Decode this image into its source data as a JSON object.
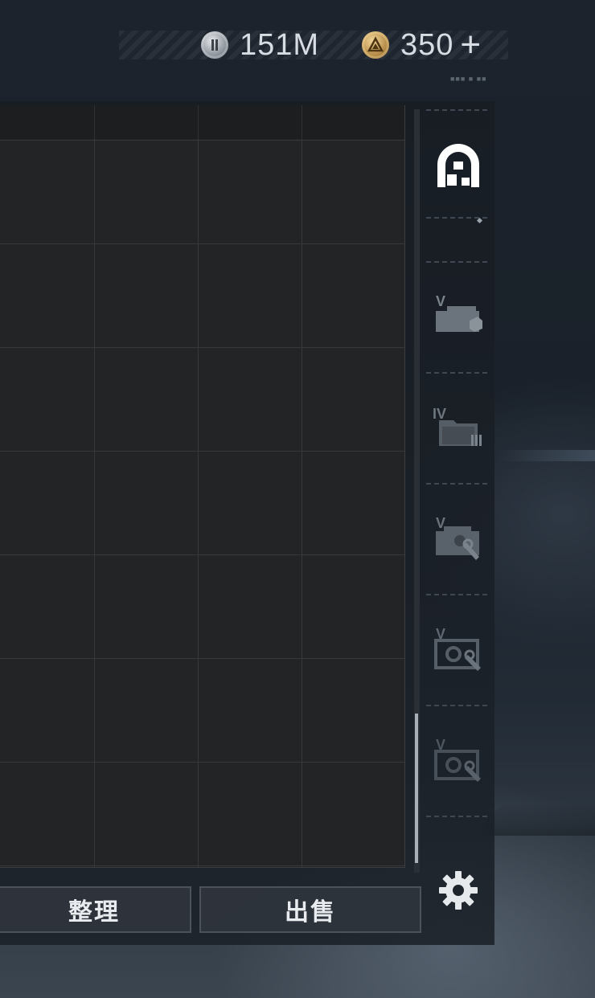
{
  "currency": {
    "silver_amount": "151M",
    "gold_amount": "350",
    "add_symbol": "+",
    "silver_icon": "silver-coin-icon",
    "gold_icon": "gold-coin-icon"
  },
  "top_info_text": "■■■ ■ ■■",
  "buttons": {
    "sort_label": "整理",
    "sell_label": "出售"
  },
  "rail": {
    "tabs": [
      {
        "name": "tab-stash-all",
        "icon": "archway-icon",
        "active": true
      },
      {
        "name": "tab-level-v-box",
        "icon": "case-level-v-icon",
        "level": "V"
      },
      {
        "name": "tab-level-iv-folder",
        "icon": "folder-level-iv-icon",
        "level": "IV"
      },
      {
        "name": "tab-level-v-repair",
        "icon": "case-repair-level-v-icon",
        "level": "V"
      },
      {
        "name": "tab-level-v-safe",
        "icon": "safe-repair-level-v-icon",
        "level": "V"
      },
      {
        "name": "tab-level-v-safe-2",
        "icon": "safe-repair-level-v-icon",
        "level": "V"
      }
    ],
    "settings_icon": "gear-icon"
  },
  "colors": {
    "grid_bg": "#222426",
    "grid_line": "#36393c",
    "button_bg": "#2e343c",
    "text_light": "#e9ecef",
    "active_icon": "#ffffff",
    "inactive_icon": "#6b737c"
  }
}
